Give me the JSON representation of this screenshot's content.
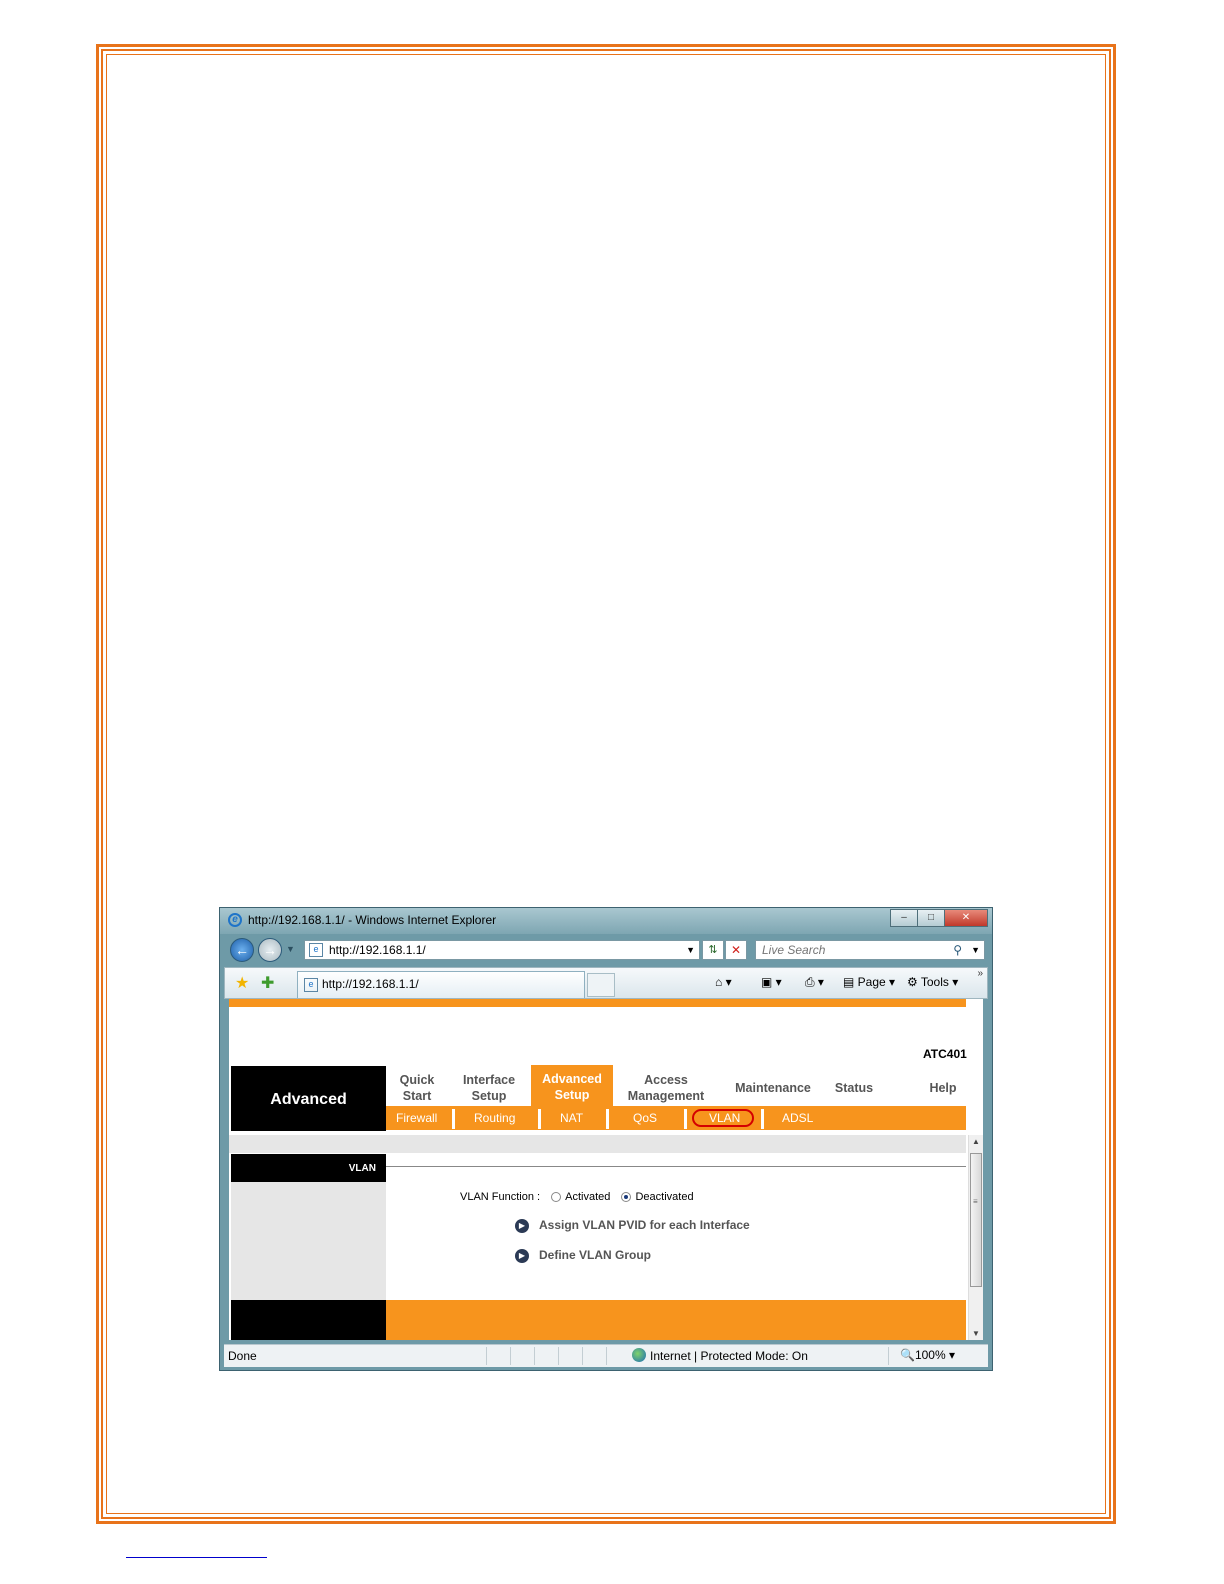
{
  "browser": {
    "title": "http://192.168.1.1/ - Windows Internet Explorer",
    "url": "http://192.168.1.1/",
    "search_placeholder": "Live Search",
    "tab_title": "http://192.168.1.1/",
    "tools": {
      "page_label": "Page",
      "tools_label": "Tools"
    },
    "status": {
      "text": "Done",
      "zone": "Internet | Protected Mode: On",
      "zoom": "100%"
    }
  },
  "router": {
    "model": "ATC401",
    "section": "Advanced",
    "menu": [
      {
        "line1": "Quick",
        "line2": "Start"
      },
      {
        "line1": "Interface",
        "line2": "Setup"
      },
      {
        "line1": "Advanced",
        "line2": "Setup"
      },
      {
        "line1": "Access",
        "line2": "Management"
      },
      {
        "line1": "Maintenance",
        "line2": ""
      },
      {
        "line1": "Status",
        "line2": ""
      },
      {
        "line1": "Help",
        "line2": ""
      }
    ],
    "submenu": [
      "Firewall",
      "Routing",
      "NAT",
      "QoS",
      "VLAN",
      "ADSL"
    ],
    "page_label": "VLAN",
    "vlan_function_label": "VLAN Function :",
    "option_activated": "Activated",
    "option_deactivated": "Deactivated",
    "selected_option": "Deactivated",
    "links": [
      "Assign VLAN PVID for each Interface",
      "Define VLAN Group"
    ]
  },
  "colors": {
    "accent": "#f7941d",
    "frame": "#e8731a",
    "highlight_circle": "#d40000"
  }
}
